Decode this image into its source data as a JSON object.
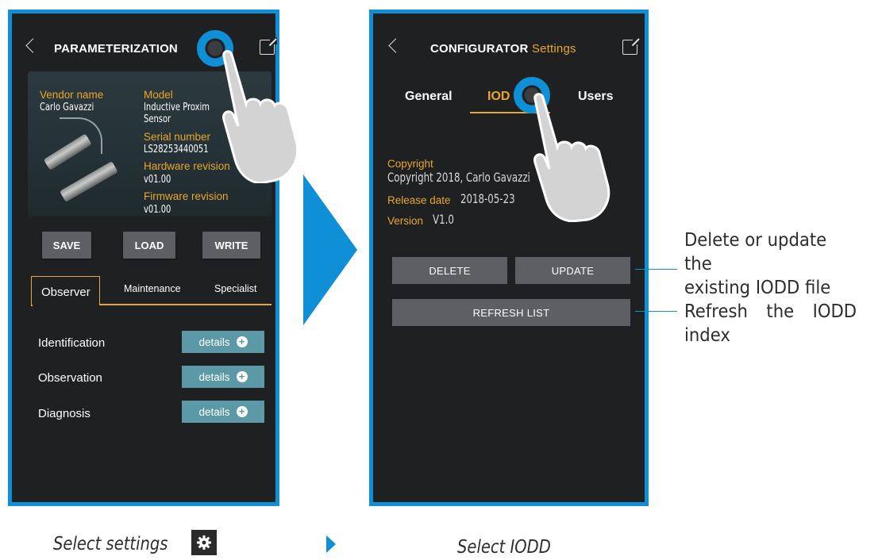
{
  "left_screen": {
    "title": "PARAMETERIZATION",
    "device": {
      "vendor_label": "Vendor name",
      "vendor_value": "Carlo Gavazzi",
      "model_label": "Model",
      "model_value_line1": "Inductive Proxim",
      "model_value_line2": "Sensor",
      "serial_label": "Serial number",
      "serial_value": "LS28253440051",
      "hardware_label": "Hardware revision",
      "hardware_value": "v01.00",
      "firmware_label": "Firmware revision",
      "firmware_value": "v01.00"
    },
    "buttons": {
      "save": "SAVE",
      "load": "LOAD",
      "write": "WRITE"
    },
    "tabs": [
      "Observer",
      "Maintenance",
      "Specialist"
    ],
    "rows": [
      {
        "label": "Identification",
        "button": "details"
      },
      {
        "label": "Observation",
        "button": "details"
      },
      {
        "label": "Diagnosis",
        "button": "details"
      }
    ]
  },
  "right_screen": {
    "title_bold": "CONFIGURATOR",
    "title_accent": "Settings",
    "tabs": [
      "General",
      "IOD",
      "Users"
    ],
    "copyright_label": "Copyright",
    "copyright_value": "Copyright 2018, Carlo Gavazzi",
    "release_label": "Release date",
    "release_value": "2018-05-23",
    "version_label": "Version",
    "version_value": "V1.0",
    "delete_button": "DELETE",
    "update_button": "UPDATE",
    "refresh_button": "REFRESH LIST"
  },
  "captions": {
    "left": "Select settings",
    "right": "Select IODD"
  },
  "callouts": {
    "delete_update_line1": "Delete or update the",
    "delete_update_line2": "existing IODD file",
    "refresh_words": [
      "Refresh",
      "the",
      "IODD"
    ],
    "refresh_line2": "index"
  },
  "colors": {
    "accent": "#e8a72b",
    "frame_blue": "#0f8fd6",
    "screen_bg": "#1f2022",
    "button_gray": "#5d5f62",
    "details_teal": "#5b99a6"
  }
}
